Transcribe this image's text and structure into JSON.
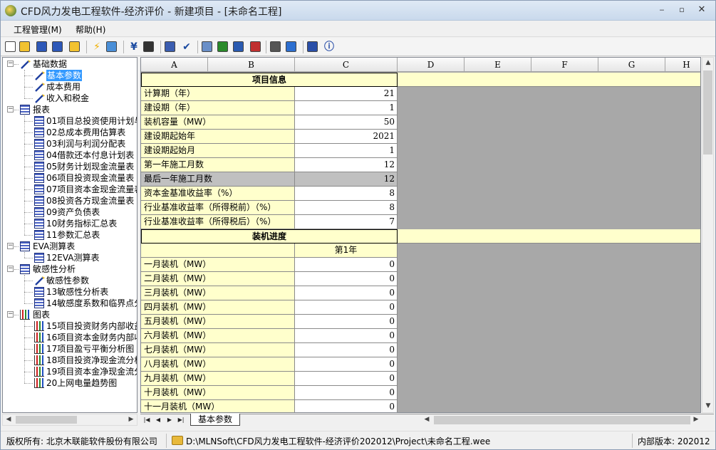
{
  "window": {
    "title": "CFD风力发电工程软件-经济评价 - 新建项目 - [未命名工程]",
    "minimize": "‒",
    "restore": "▫",
    "close": "✕"
  },
  "menu": {
    "items": [
      "工程管理(M)",
      "帮助(H)"
    ]
  },
  "toolbar": {
    "icons": [
      "new-icon",
      "open-icon",
      "save-icon",
      "save-as-icon",
      "folder-icon",
      "lightning-icon",
      "chart-update-icon",
      "currency-icon",
      "tool-icon",
      "calculator-icon",
      "check-icon",
      "print-preview-icon",
      "excel-export-icon",
      "word-export-icon",
      "bar-chart-icon",
      "settings-icon",
      "export-icon",
      "book-icon",
      "info-icon"
    ]
  },
  "tree": {
    "groups": [
      {
        "label": "基础数据",
        "icon": "wand-icon",
        "children": [
          {
            "label": "基本参数",
            "icon": "wand-icon",
            "selected": true
          },
          {
            "label": "成本费用",
            "icon": "wand-icon"
          },
          {
            "label": "收入和税金",
            "icon": "wand-icon"
          }
        ]
      },
      {
        "label": "报表",
        "icon": "table-icon",
        "children": [
          {
            "label": "01项目总投资使用计划与",
            "icon": "table-icon"
          },
          {
            "label": "02总成本费用估算表",
            "icon": "table-icon"
          },
          {
            "label": "03利润与利润分配表",
            "icon": "table-icon"
          },
          {
            "label": "04借款还本付息计划表",
            "icon": "table-icon"
          },
          {
            "label": "05财务计划现金流量表",
            "icon": "table-icon"
          },
          {
            "label": "06项目投资现金流量表",
            "icon": "table-icon"
          },
          {
            "label": "07项目资本金现金流量表",
            "icon": "table-icon"
          },
          {
            "label": "08投资各方现金流量表",
            "icon": "table-icon"
          },
          {
            "label": "09资产负债表",
            "icon": "table-icon"
          },
          {
            "label": "10财务指标汇总表",
            "icon": "table-icon"
          },
          {
            "label": "11参数汇总表",
            "icon": "table-icon"
          }
        ]
      },
      {
        "label": "EVA测算表",
        "icon": "table-icon",
        "children": [
          {
            "label": "12EVA测算表",
            "icon": "table-icon"
          }
        ]
      },
      {
        "label": "敏感性分析",
        "icon": "table-icon",
        "children": [
          {
            "label": "敏感性参数",
            "icon": "wand-icon"
          },
          {
            "label": "13敏感性分析表",
            "icon": "table-icon"
          },
          {
            "label": "14敏感度系数和临界点分",
            "icon": "table-icon"
          }
        ]
      },
      {
        "label": "图表",
        "icon": "chart-icon",
        "children": [
          {
            "label": "15项目投资财务内部收益",
            "icon": "chart-icon"
          },
          {
            "label": "16项目资本金财务内部收",
            "icon": "chart-icon"
          },
          {
            "label": "17项目盈亏平衡分析图",
            "icon": "chart-icon"
          },
          {
            "label": "18项目投资净现金流分析",
            "icon": "chart-icon"
          },
          {
            "label": "19项目资本金净现金流分",
            "icon": "chart-icon"
          },
          {
            "label": "20上网电量趋势图",
            "icon": "chart-icon"
          }
        ]
      }
    ]
  },
  "grid": {
    "columns": [
      "A",
      "B",
      "C",
      "D",
      "E",
      "F",
      "G",
      "H"
    ],
    "section1_title": "项目信息",
    "info_rows": [
      {
        "label": "计算期（年）",
        "value": "21"
      },
      {
        "label": "建设期（年）",
        "value": "1"
      },
      {
        "label": "装机容量（MW）",
        "value": "50"
      },
      {
        "label": "建设期起始年",
        "value": "2021"
      },
      {
        "label": "建设期起始月",
        "value": "1"
      },
      {
        "label": "第一年施工月数",
        "value": "12"
      },
      {
        "label": "最后一年施工月数",
        "value": "12",
        "readonly": true
      },
      {
        "label": "资本金基准收益率（%）",
        "value": "8"
      },
      {
        "label": "行业基准收益率（所得税前）（%）",
        "value": "8"
      },
      {
        "label": "行业基准收益率（所得税后）（%）",
        "value": "7"
      }
    ],
    "section2_title": "装机进度",
    "progress_header": "第1年",
    "progress_rows": [
      {
        "label": "一月装机（MW）",
        "value": "0"
      },
      {
        "label": "二月装机（MW）",
        "value": "0"
      },
      {
        "label": "三月装机（MW）",
        "value": "0"
      },
      {
        "label": "四月装机（MW）",
        "value": "0"
      },
      {
        "label": "五月装机（MW）",
        "value": "0"
      },
      {
        "label": "六月装机（MW）",
        "value": "0"
      },
      {
        "label": "七月装机（MW）",
        "value": "0"
      },
      {
        "label": "八月装机（MW）",
        "value": "0"
      },
      {
        "label": "九月装机（MW）",
        "value": "0"
      },
      {
        "label": "十月装机（MW）",
        "value": "0"
      },
      {
        "label": "十一月装机（MW）",
        "value": "0"
      }
    ]
  },
  "sheet_tab": "基本参数",
  "status": {
    "copyright": "版权所有: 北京木联能软件股份有限公司",
    "path": "D:\\MLNSoft\\CFD风力发电工程软件-经济评价202012\\Project\\未命名工程.wee",
    "version": "内部版本: 202012"
  },
  "colors": {
    "label_bg": "#ffffcc",
    "readonly_bg": "#c0c0c0",
    "selection": "#3399ff"
  }
}
